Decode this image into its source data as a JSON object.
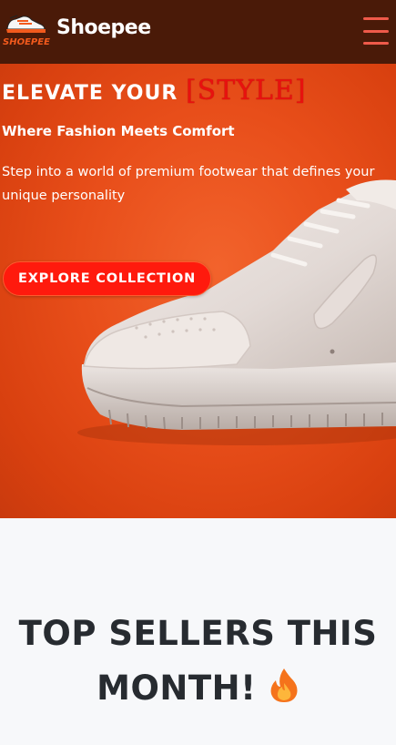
{
  "header": {
    "logo_text": "SHOEPEE",
    "brand_name": "Shoepee",
    "menu_icon": "hamburger-menu-icon"
  },
  "hero": {
    "title": "ELEVATE YOUR",
    "title_accent": "[STYLE]",
    "subtitle": "Where Fashion Meets Comfort",
    "description": "Step into a world of premium footwear that defines your unique personality",
    "cta_label": "EXPLORE COLLECTION",
    "image": "white-sneaker-on-orange-background"
  },
  "sellers": {
    "title": "TOP SELLERS THIS MONTH!",
    "icon": "fire-icon"
  },
  "colors": {
    "header_bg": "#4a1a08",
    "hero_bg": "#e84e1a",
    "accent_red": "#e8110f",
    "cta_bg": "#ff1a0d",
    "menu_icon": "#ef5a4a",
    "heading_text": "#272b30"
  }
}
